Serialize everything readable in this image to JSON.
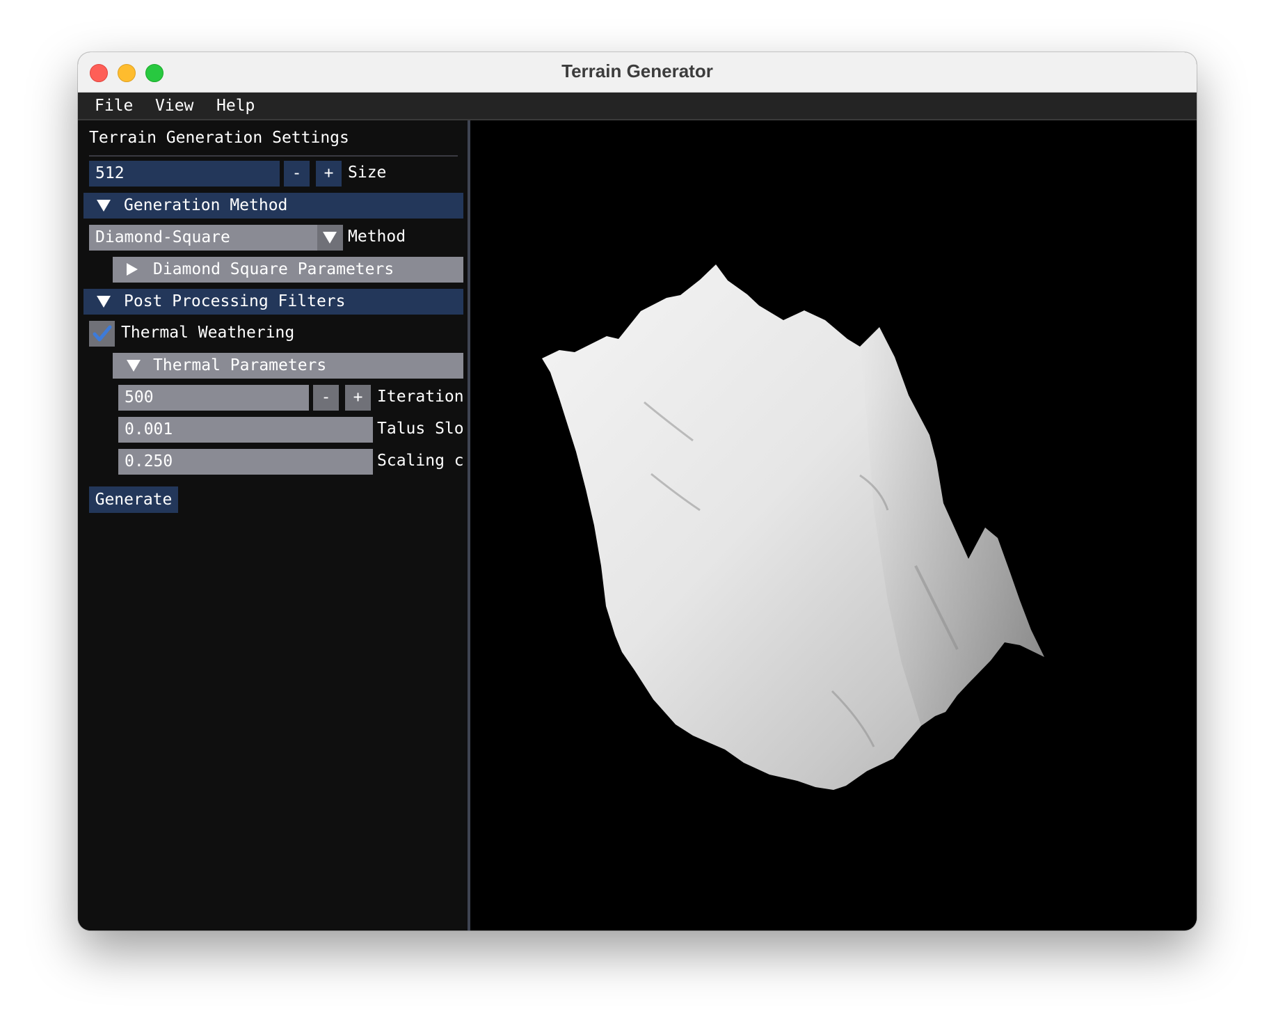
{
  "window": {
    "title": "Terrain Generator"
  },
  "menu": {
    "file": "File",
    "view": "View",
    "help": "Help"
  },
  "panel": {
    "title": "Terrain Generation Settings",
    "size": {
      "value": "512",
      "minus": "-",
      "plus": "+",
      "label": "Size"
    },
    "generation_method": {
      "header": "Generation Method",
      "method_value": "Diamond-Square",
      "method_label": "Method",
      "params_header": "Diamond Square Parameters"
    },
    "post_processing": {
      "header": "Post Processing Filters",
      "thermal_label": "Thermal Weathering",
      "thermal_checked": true,
      "thermal_params_header": "Thermal Parameters",
      "iterations": {
        "value": "500",
        "minus": "-",
        "plus": "+",
        "label": "Iteration"
      },
      "talus": {
        "value": "0.001",
        "label": "Talus Slo"
      },
      "scaling": {
        "value": "0.250",
        "label": "Scaling c"
      }
    },
    "generate_label": "Generate"
  },
  "colors": {
    "accent": "#23375a",
    "frame_bg": "#8a8b94",
    "checkmark": "#3d7bd9",
    "terrain": "#eeeeee"
  },
  "icons": {
    "expanded": "triangle-down-icon",
    "collapsed": "triangle-right-icon",
    "check": "check-icon"
  }
}
